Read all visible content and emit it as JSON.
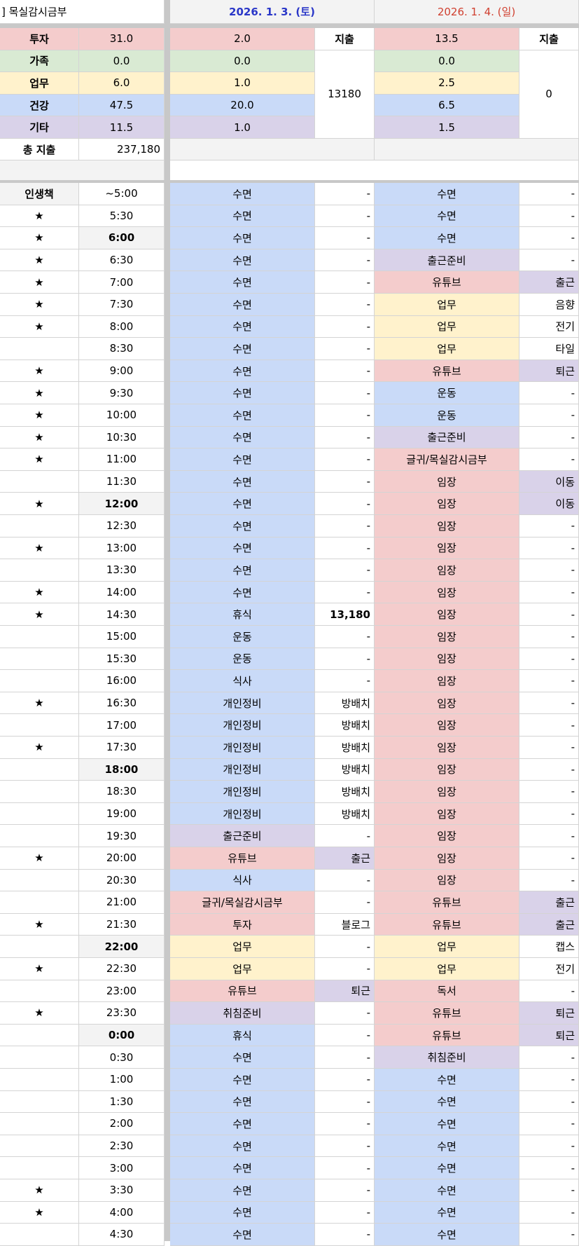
{
  "title": "] 목실감시금부",
  "colors": {
    "투자": "#f4cccc",
    "가족": "#d9ead3",
    "업무": "#fff2cc",
    "건강": "#c9daf8",
    "기타": "#d9d2e9",
    "grey": "#f3f3f3",
    "date1": "#2a37c8",
    "date2": "#d04030"
  },
  "days": [
    {
      "date": "2026. 1. 3. (토)",
      "expense_header": "지출",
      "expense_total": "13180",
      "cats": {
        "투자": "2.0",
        "가족": "0.0",
        "업무": "1.0",
        "건강": "20.0",
        "기타": "1.0"
      }
    },
    {
      "date": "2026. 1. 4. (일)",
      "expense_header": "지출",
      "expense_total": "0",
      "cats": {
        "투자": "13.5",
        "가족": "0.0",
        "업무": "2.5",
        "건강": "6.5",
        "기타": "1.5"
      }
    }
  ],
  "categories": [
    {
      "name": "투자",
      "total": "31.0"
    },
    {
      "name": "가족",
      "total": "0.0"
    },
    {
      "name": "업무",
      "total": "6.0"
    },
    {
      "name": "건강",
      "total": "47.5"
    },
    {
      "name": "기타",
      "total": "11.5"
    }
  ],
  "total_expense": {
    "label": "총 지출",
    "value": "237,180"
  },
  "schedule_header": {
    "label": "인생책",
    "time": "~5:00"
  },
  "rows": [
    {
      "time": "~5:00",
      "star": false,
      "d1": "수면",
      "d1c": "건강",
      "e1": "-",
      "e1c": "",
      "d2": "수면",
      "d2c": "건강",
      "e2": "-",
      "e2c": ""
    },
    {
      "time": "5:30",
      "star": true,
      "d1": "수면",
      "d1c": "건강",
      "e1": "-",
      "e1c": "",
      "d2": "수면",
      "d2c": "건강",
      "e2": "-",
      "e2c": ""
    },
    {
      "time": "6:00",
      "star": true,
      "bold": true,
      "d1": "수면",
      "d1c": "건강",
      "e1": "-",
      "e1c": "",
      "d2": "수면",
      "d2c": "건강",
      "e2": "-",
      "e2c": ""
    },
    {
      "time": "6:30",
      "star": true,
      "d1": "수면",
      "d1c": "건강",
      "e1": "-",
      "e1c": "",
      "d2": "출근준비",
      "d2c": "기타",
      "e2": "-",
      "e2c": ""
    },
    {
      "time": "7:00",
      "star": true,
      "d1": "수면",
      "d1c": "건강",
      "e1": "-",
      "e1c": "",
      "d2": "유튜브",
      "d2c": "투자",
      "e2": "출근",
      "e2c": "기타"
    },
    {
      "time": "7:30",
      "star": true,
      "d1": "수면",
      "d1c": "건강",
      "e1": "-",
      "e1c": "",
      "d2": "업무",
      "d2c": "업무",
      "e2": "음향",
      "e2c": ""
    },
    {
      "time": "8:00",
      "star": true,
      "d1": "수면",
      "d1c": "건강",
      "e1": "-",
      "e1c": "",
      "d2": "업무",
      "d2c": "업무",
      "e2": "전기",
      "e2c": ""
    },
    {
      "time": "8:30",
      "star": false,
      "d1": "수면",
      "d1c": "건강",
      "e1": "-",
      "e1c": "",
      "d2": "업무",
      "d2c": "업무",
      "e2": "타일",
      "e2c": ""
    },
    {
      "time": "9:00",
      "star": true,
      "d1": "수면",
      "d1c": "건강",
      "e1": "-",
      "e1c": "",
      "d2": "유튜브",
      "d2c": "투자",
      "e2": "퇴근",
      "e2c": "기타"
    },
    {
      "time": "9:30",
      "star": true,
      "d1": "수면",
      "d1c": "건강",
      "e1": "-",
      "e1c": "",
      "d2": "운동",
      "d2c": "건강",
      "e2": "-",
      "e2c": ""
    },
    {
      "time": "10:00",
      "star": true,
      "d1": "수면",
      "d1c": "건강",
      "e1": "-",
      "e1c": "",
      "d2": "운동",
      "d2c": "건강",
      "e2": "-",
      "e2c": ""
    },
    {
      "time": "10:30",
      "star": true,
      "d1": "수면",
      "d1c": "건강",
      "e1": "-",
      "e1c": "",
      "d2": "출근준비",
      "d2c": "기타",
      "e2": "-",
      "e2c": ""
    },
    {
      "time": "11:00",
      "star": true,
      "d1": "수면",
      "d1c": "건강",
      "e1": "-",
      "e1c": "",
      "d2": "글귀/목실감시금부",
      "d2c": "투자",
      "e2": "-",
      "e2c": ""
    },
    {
      "time": "11:30",
      "star": false,
      "d1": "수면",
      "d1c": "건강",
      "e1": "-",
      "e1c": "",
      "d2": "임장",
      "d2c": "투자",
      "e2": "이동",
      "e2c": "기타"
    },
    {
      "time": "12:00",
      "star": true,
      "bold": true,
      "d1": "수면",
      "d1c": "건강",
      "e1": "-",
      "e1c": "",
      "d2": "임장",
      "d2c": "투자",
      "e2": "이동",
      "e2c": "기타"
    },
    {
      "time": "12:30",
      "star": false,
      "d1": "수면",
      "d1c": "건강",
      "e1": "-",
      "e1c": "",
      "d2": "임장",
      "d2c": "투자",
      "e2": "-",
      "e2c": ""
    },
    {
      "time": "13:00",
      "star": true,
      "d1": "수면",
      "d1c": "건강",
      "e1": "-",
      "e1c": "",
      "d2": "임장",
      "d2c": "투자",
      "e2": "-",
      "e2c": ""
    },
    {
      "time": "13:30",
      "star": false,
      "d1": "수면",
      "d1c": "건강",
      "e1": "-",
      "e1c": "",
      "d2": "임장",
      "d2c": "투자",
      "e2": "-",
      "e2c": ""
    },
    {
      "time": "14:00",
      "star": true,
      "d1": "수면",
      "d1c": "건강",
      "e1": "-",
      "e1c": "",
      "d2": "임장",
      "d2c": "투자",
      "e2": "-",
      "e2c": ""
    },
    {
      "time": "14:30",
      "star": true,
      "d1": "휴식",
      "d1c": "건강",
      "e1": "13,180",
      "e1c": "",
      "e1bold": true,
      "d2": "임장",
      "d2c": "투자",
      "e2": "-",
      "e2c": ""
    },
    {
      "time": "15:00",
      "star": false,
      "d1": "운동",
      "d1c": "건강",
      "e1": "-",
      "e1c": "",
      "d2": "임장",
      "d2c": "투자",
      "e2": "-",
      "e2c": ""
    },
    {
      "time": "15:30",
      "star": false,
      "d1": "운동",
      "d1c": "건강",
      "e1": "-",
      "e1c": "",
      "d2": "임장",
      "d2c": "투자",
      "e2": "-",
      "e2c": ""
    },
    {
      "time": "16:00",
      "star": false,
      "d1": "식사",
      "d1c": "건강",
      "e1": "-",
      "e1c": "",
      "d2": "임장",
      "d2c": "투자",
      "e2": "-",
      "e2c": ""
    },
    {
      "time": "16:30",
      "star": true,
      "d1": "개인정비",
      "d1c": "건강",
      "e1": "방배치",
      "e1c": "",
      "d2": "임장",
      "d2c": "투자",
      "e2": "-",
      "e2c": ""
    },
    {
      "time": "17:00",
      "star": false,
      "d1": "개인정비",
      "d1c": "건강",
      "e1": "방배치",
      "e1c": "",
      "d2": "임장",
      "d2c": "투자",
      "e2": "-",
      "e2c": ""
    },
    {
      "time": "17:30",
      "star": true,
      "d1": "개인정비",
      "d1c": "건강",
      "e1": "방배치",
      "e1c": "",
      "d2": "임장",
      "d2c": "투자",
      "e2": "-",
      "e2c": ""
    },
    {
      "time": "18:00",
      "star": false,
      "bold": true,
      "d1": "개인정비",
      "d1c": "건강",
      "e1": "방배치",
      "e1c": "",
      "d2": "임장",
      "d2c": "투자",
      "e2": "-",
      "e2c": ""
    },
    {
      "time": "18:30",
      "star": false,
      "d1": "개인정비",
      "d1c": "건강",
      "e1": "방배치",
      "e1c": "",
      "d2": "임장",
      "d2c": "투자",
      "e2": "-",
      "e2c": ""
    },
    {
      "time": "19:00",
      "star": false,
      "d1": "개인정비",
      "d1c": "건강",
      "e1": "방배치",
      "e1c": "",
      "d2": "임장",
      "d2c": "투자",
      "e2": "-",
      "e2c": ""
    },
    {
      "time": "19:30",
      "star": false,
      "d1": "출근준비",
      "d1c": "기타",
      "e1": "-",
      "e1c": "",
      "d2": "임장",
      "d2c": "투자",
      "e2": "-",
      "e2c": ""
    },
    {
      "time": "20:00",
      "star": true,
      "d1": "유튜브",
      "d1c": "투자",
      "e1": "출근",
      "e1c": "기타",
      "d2": "임장",
      "d2c": "투자",
      "e2": "-",
      "e2c": ""
    },
    {
      "time": "20:30",
      "star": false,
      "d1": "식사",
      "d1c": "건강",
      "e1": "-",
      "e1c": "",
      "d2": "임장",
      "d2c": "투자",
      "e2": "-",
      "e2c": ""
    },
    {
      "time": "21:00",
      "star": false,
      "d1": "글귀/목실감시금부",
      "d1c": "투자",
      "e1": "-",
      "e1c": "",
      "d2": "유튜브",
      "d2c": "투자",
      "e2": "출근",
      "e2c": "기타"
    },
    {
      "time": "21:30",
      "star": true,
      "d1": "투자",
      "d1c": "투자",
      "e1": "블로그",
      "e1c": "",
      "d2": "유튜브",
      "d2c": "투자",
      "e2": "출근",
      "e2c": "기타"
    },
    {
      "time": "22:00",
      "star": false,
      "bold": true,
      "d1": "업무",
      "d1c": "업무",
      "e1": "-",
      "e1c": "",
      "d2": "업무",
      "d2c": "업무",
      "e2": "캡스",
      "e2c": ""
    },
    {
      "time": "22:30",
      "star": true,
      "d1": "업무",
      "d1c": "업무",
      "e1": "-",
      "e1c": "",
      "d2": "업무",
      "d2c": "업무",
      "e2": "전기",
      "e2c": ""
    },
    {
      "time": "23:00",
      "star": false,
      "d1": "유튜브",
      "d1c": "투자",
      "e1": "퇴근",
      "e1c": "기타",
      "d2": "독서",
      "d2c": "투자",
      "e2": "-",
      "e2c": ""
    },
    {
      "time": "23:30",
      "star": true,
      "d1": "취침준비",
      "d1c": "기타",
      "e1": "-",
      "e1c": "",
      "d2": "유튜브",
      "d2c": "투자",
      "e2": "퇴근",
      "e2c": "기타"
    },
    {
      "time": "0:00",
      "star": false,
      "bold": true,
      "d1": "휴식",
      "d1c": "건강",
      "e1": "-",
      "e1c": "",
      "d2": "유튜브",
      "d2c": "투자",
      "e2": "퇴근",
      "e2c": "기타"
    },
    {
      "time": "0:30",
      "star": false,
      "d1": "수면",
      "d1c": "건강",
      "e1": "-",
      "e1c": "",
      "d2": "취침준비",
      "d2c": "기타",
      "e2": "-",
      "e2c": ""
    },
    {
      "time": "1:00",
      "star": false,
      "d1": "수면",
      "d1c": "건강",
      "e1": "-",
      "e1c": "",
      "d2": "수면",
      "d2c": "건강",
      "e2": "-",
      "e2c": ""
    },
    {
      "time": "1:30",
      "star": false,
      "d1": "수면",
      "d1c": "건강",
      "e1": "-",
      "e1c": "",
      "d2": "수면",
      "d2c": "건강",
      "e2": "-",
      "e2c": ""
    },
    {
      "time": "2:00",
      "star": false,
      "d1": "수면",
      "d1c": "건강",
      "e1": "-",
      "e1c": "",
      "d2": "수면",
      "d2c": "건강",
      "e2": "-",
      "e2c": ""
    },
    {
      "time": "2:30",
      "star": false,
      "d1": "수면",
      "d1c": "건강",
      "e1": "-",
      "e1c": "",
      "d2": "수면",
      "d2c": "건강",
      "e2": "-",
      "e2c": ""
    },
    {
      "time": "3:00",
      "star": false,
      "d1": "수면",
      "d1c": "건강",
      "e1": "-",
      "e1c": "",
      "d2": "수면",
      "d2c": "건강",
      "e2": "-",
      "e2c": ""
    },
    {
      "time": "3:30",
      "star": true,
      "d1": "수면",
      "d1c": "건강",
      "e1": "-",
      "e1c": "",
      "d2": "수면",
      "d2c": "건강",
      "e2": "-",
      "e2c": ""
    },
    {
      "time": "4:00",
      "star": true,
      "d1": "수면",
      "d1c": "건강",
      "e1": "-",
      "e1c": "",
      "d2": "수면",
      "d2c": "건강",
      "e2": "-",
      "e2c": ""
    },
    {
      "time": "4:30",
      "star": false,
      "d1": "수면",
      "d1c": "건강",
      "e1": "-",
      "e1c": "",
      "d2": "수면",
      "d2c": "건강",
      "e2": "-",
      "e2c": ""
    }
  ],
  "star_glyph": "★"
}
